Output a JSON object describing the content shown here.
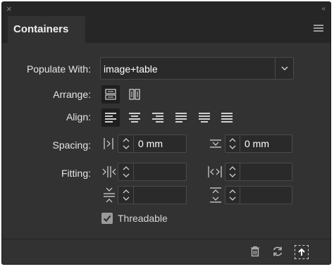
{
  "panel": {
    "collapse_glyph": "«",
    "close_glyph": "×",
    "tab_title": "Containers"
  },
  "populate": {
    "label": "Populate With:",
    "value": "image+table",
    "dropdown_glyph": "⌄"
  },
  "arrange": {
    "label": "Arrange:",
    "options": [
      {
        "icon": "arrange-horizontal-icon",
        "selected": true
      },
      {
        "icon": "arrange-vertical-icon",
        "selected": false
      }
    ]
  },
  "align": {
    "label": "Align:",
    "options": [
      {
        "icon": "align-left-icon",
        "selected": true
      },
      {
        "icon": "align-center-icon",
        "selected": false
      },
      {
        "icon": "align-right-icon",
        "selected": false
      },
      {
        "icon": "justify-left-icon",
        "selected": false
      },
      {
        "icon": "justify-center-icon",
        "selected": false
      },
      {
        "icon": "justify-all-icon",
        "selected": false
      }
    ]
  },
  "spacing": {
    "label": "Spacing:",
    "horizontal_value": "0 mm",
    "vertical_value": "0 mm"
  },
  "fitting": {
    "label": "Fitting:",
    "fields": [
      "",
      "",
      "",
      ""
    ]
  },
  "threadable": {
    "label": "Threadable",
    "checked": true
  },
  "footer": {
    "icons": [
      "trash-icon",
      "refresh-icon",
      "export-icon"
    ]
  }
}
